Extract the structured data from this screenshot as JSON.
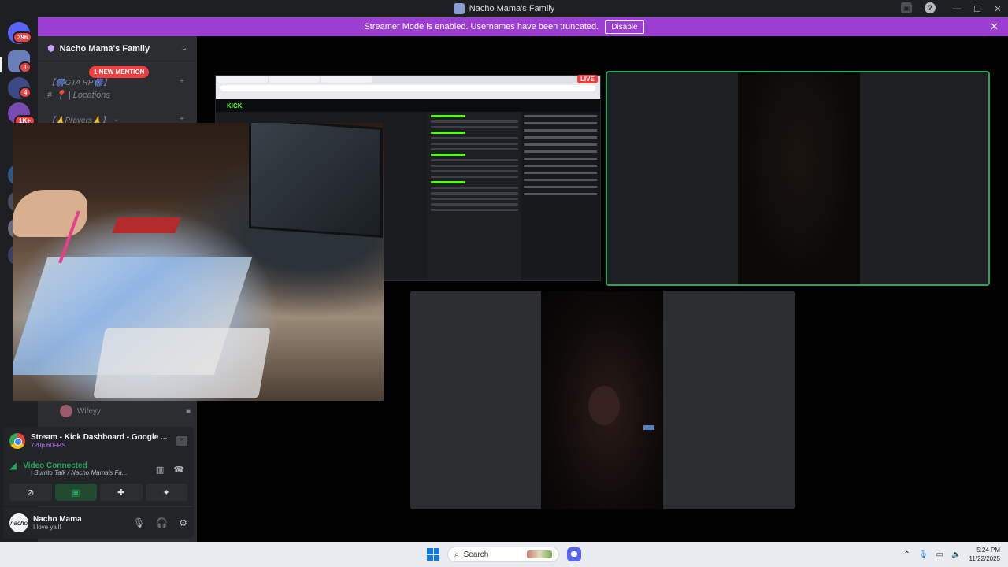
{
  "window": {
    "title": "Nacho Mama's Family",
    "controls": [
      "—",
      "☐",
      "✕"
    ]
  },
  "banner": {
    "message": "Streamer Mode is enabled. Usernames have been truncated.",
    "button": "Disable"
  },
  "rail": {
    "badges": [
      {
        "label": "396"
      },
      {
        "label": "1"
      },
      {
        "label": "4"
      },
      {
        "label": "1K+"
      }
    ]
  },
  "server": {
    "name": "Nacho Mama's Family",
    "mention": "1 NEW MENTION",
    "channels": [
      {
        "label": "【🎆GTA RP🎆】"
      },
      {
        "label": "📍 | Locations"
      },
      {
        "label": "【🙏Prayers🙏】"
      }
    ],
    "voice_user": "Wifeyy"
  },
  "stream_panel": {
    "title": "Stream - Kick Dashboard - Google ...",
    "quality": "720p 60FPS"
  },
  "rtc": {
    "status": "Video Connected",
    "channel": "| Burrito Talk / Nacho Mama's Fa..."
  },
  "user": {
    "name": "Nacho Mama",
    "status": "I love yall!",
    "avatar_text": "nacho"
  },
  "stage": {
    "live_label": "LIVE",
    "kick_logo": "KICK"
  },
  "taskbar": {
    "search_placeholder": "Search",
    "time": "5:24 PM",
    "date": "11/22/2025"
  }
}
